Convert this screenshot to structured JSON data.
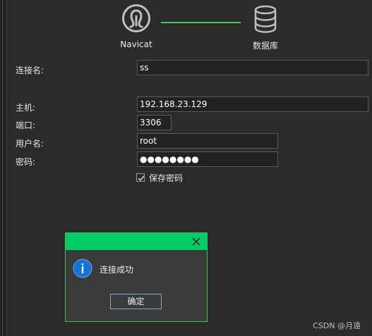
{
  "header": {
    "navicat_label": "Navicat",
    "database_label": "数据库",
    "accent_color": "#3ecf4d"
  },
  "form": {
    "connection_name": {
      "label": "连接名:",
      "value": "ss"
    },
    "host": {
      "label": "主机:",
      "value": "192.168.23.129"
    },
    "port": {
      "label": "端口:",
      "value": "3306"
    },
    "username": {
      "label": "用户名:",
      "value": "root"
    },
    "password": {
      "label": "密码:",
      "value": "●●●●●●●●"
    },
    "save_password": {
      "label": "保存密码",
      "checked": true
    }
  },
  "dialog": {
    "title": "",
    "message": "连接成功",
    "ok_label": "确定",
    "title_bar_color": "#00cc66",
    "icon": "info-icon"
  },
  "watermark": "CSDN @月遠"
}
